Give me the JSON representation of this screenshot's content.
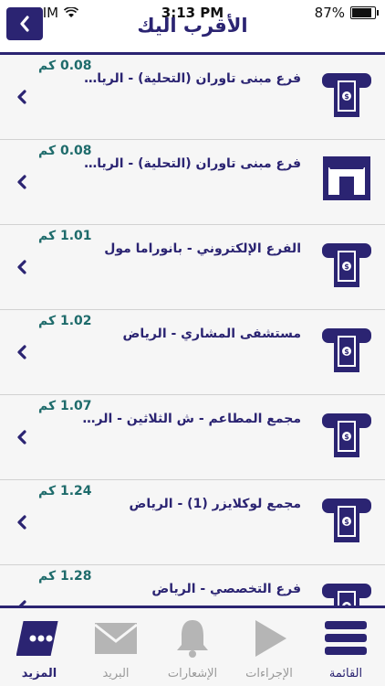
{
  "status_bar": {
    "carrier": "No SIM",
    "time": "3:13 PM",
    "battery": "87%",
    "battery_level": 0.87
  },
  "header": {
    "title": "الأقرب اليك"
  },
  "unit": "كم",
  "items": [
    {
      "name": "فرع مبنى تاوران (التحلية) - الرياض",
      "distance": "0.08",
      "icon": "atm-icon"
    },
    {
      "name": "فرع مبنى تاوران (التحلية) - الرياض",
      "distance": "0.08",
      "icon": "branch-icon"
    },
    {
      "name": "الفرع الإلكتروني - بانوراما مول",
      "distance": "1.01",
      "icon": "atm-icon"
    },
    {
      "name": "مستشفى المشاري - الرياض",
      "distance": "1.02",
      "icon": "atm-icon"
    },
    {
      "name": "مجمع المطاعم - ش الثلاثين - الرياض",
      "distance": "1.07",
      "icon": "atm-icon"
    },
    {
      "name": "مجمع لوكلايزر (1) - الرياض",
      "distance": "1.24",
      "icon": "atm-icon"
    },
    {
      "name": "فرع التخصصي - الرياض",
      "distance": "1.28",
      "icon": "atm-icon"
    }
  ],
  "tabs": [
    {
      "label": "المزيد",
      "icon": "more-icon",
      "active": true
    },
    {
      "label": "البريد",
      "icon": "mail-icon",
      "active": false
    },
    {
      "label": "الإشعارات",
      "icon": "bell-icon",
      "active": false
    },
    {
      "label": "الإجراءات",
      "icon": "play-icon",
      "active": false
    },
    {
      "label": "القائمة",
      "icon": "menu-icon",
      "active": false
    }
  ],
  "colors": {
    "brand": "#2b2472",
    "distance": "#1e6b6b",
    "inactive": "#9a9a9a"
  }
}
